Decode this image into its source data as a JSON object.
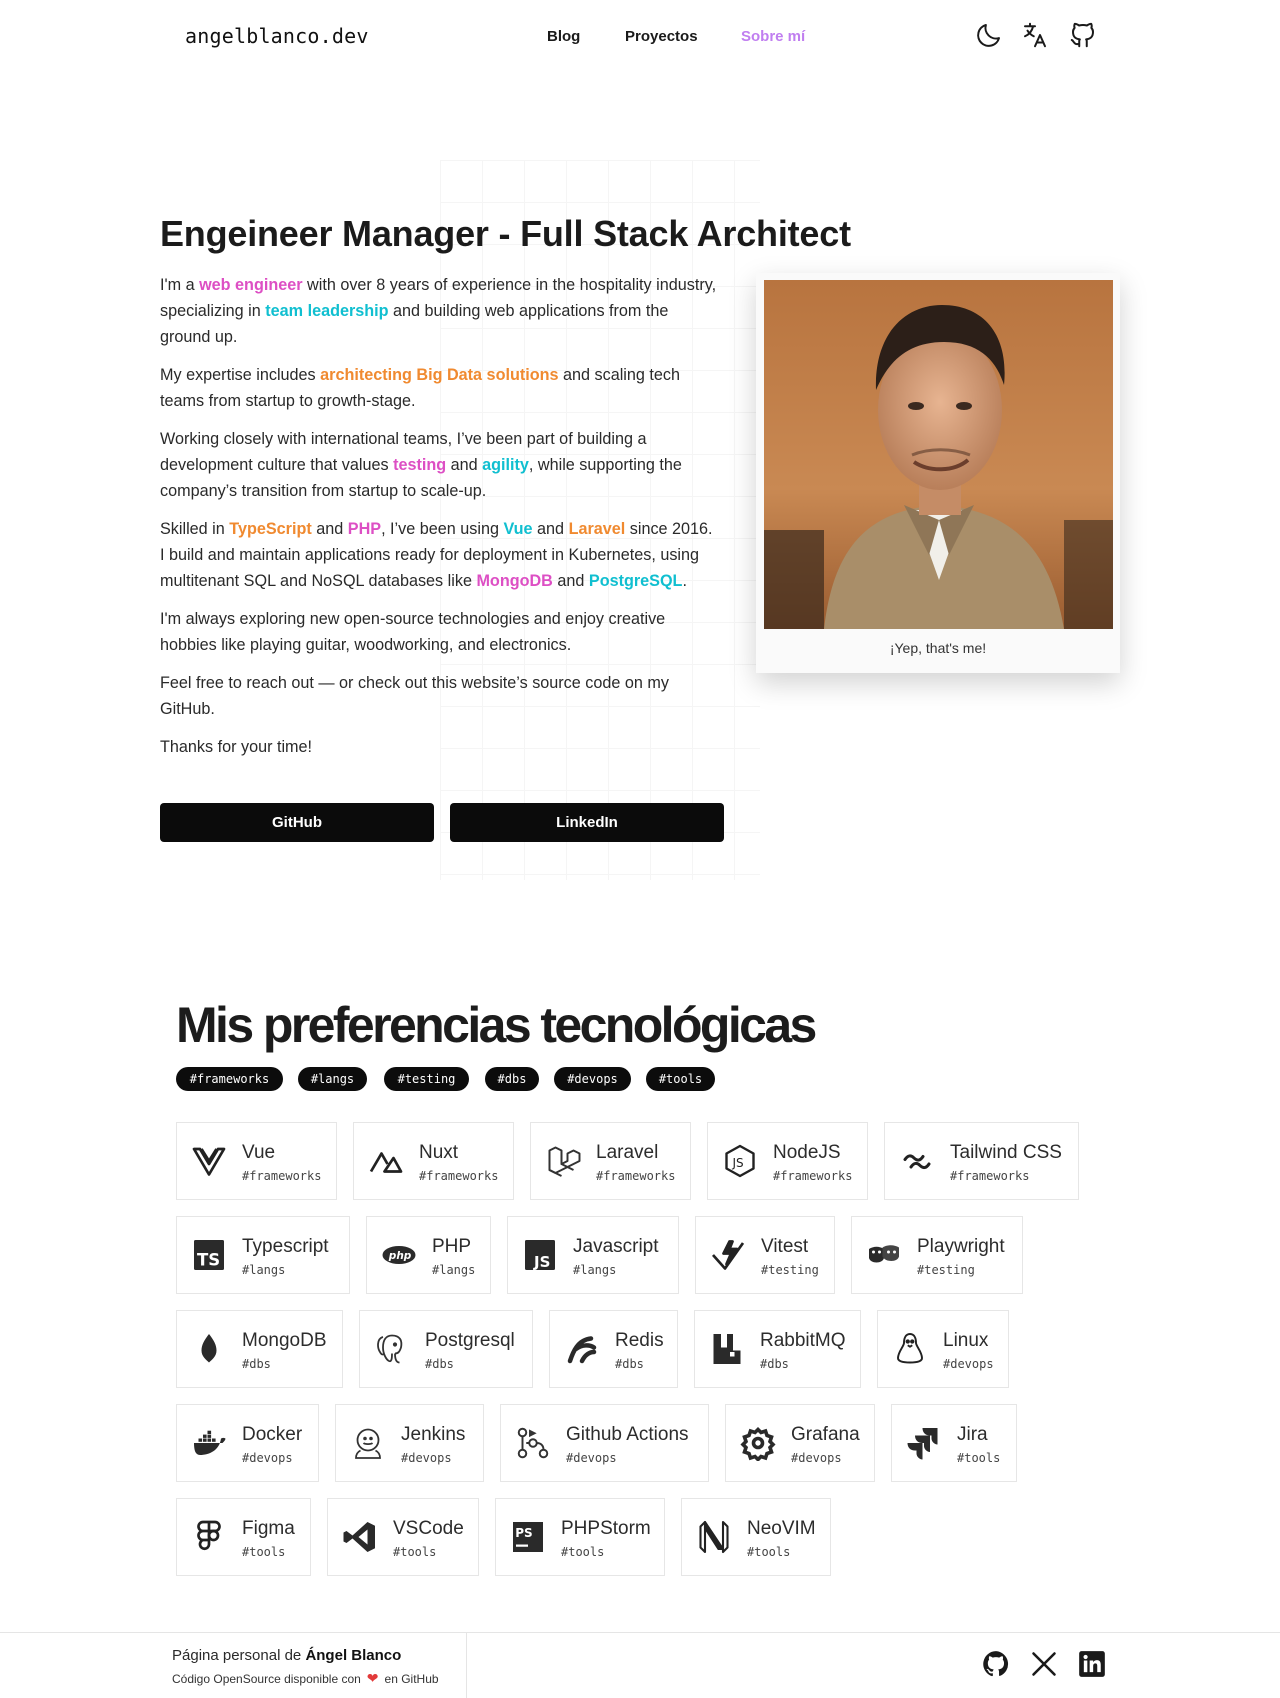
{
  "header": {
    "logo": "angelblanco.dev",
    "nav": [
      "Blog",
      "Proyectos",
      "Sobre mí"
    ],
    "icons": [
      "moon-icon",
      "translate-icon",
      "github-icon"
    ],
    "active_color": "#c07ef0"
  },
  "hero": {
    "title": "Engeineer Manager - Full Stack Architect",
    "p1": [
      "I'm a ",
      "web engineer",
      " with over 8 years of experience in the hospitality industry, specializing in ",
      "team leadership",
      " and building web applications from the ground up."
    ],
    "p2": [
      "My expertise includes ",
      "architecting Big Data solutions",
      " and scaling tech teams from startup to growth-stage."
    ],
    "p3": [
      "Working closely with international teams, I’ve been part of building a development culture that values ",
      "testing",
      " and ",
      "agility",
      ", while supporting the company’s transition from startup to scale-up."
    ],
    "p4": [
      "Skilled in ",
      "TypeScript",
      " and ",
      "PHP",
      ", I’ve been using ",
      "Vue",
      " and ",
      "Laravel",
      " since 2016. I build and maintain applications ready for deployment in Kubernetes, using multitenant SQL and NoSQL databases like ",
      "MongoDB",
      " and ",
      "PostgreSQL",
      "."
    ],
    "p5": "I'm always exploring new open-source technologies and enjoy creative hobbies like playing guitar, woodworking, and electronics.",
    "p6": "Feel free to reach out — or check out this website’s source code on my GitHub.",
    "p7": "Thanks for your time!",
    "buttons": [
      "GitHub",
      "LinkedIn"
    ],
    "photo_caption": "¡Yep, that's me!",
    "colors": {
      "pink": "#dd4fc4",
      "cyan": "#10bfd0",
      "orange": "#f08a30"
    }
  },
  "tech": {
    "title": "Mis preferencias tecnológicas",
    "tags": [
      "#frameworks",
      "#langs",
      "#testing",
      "#dbs",
      "#devops",
      "#tools"
    ],
    "items": [
      {
        "name": "Vue",
        "tag": "#frameworks",
        "icon": "vue-icon"
      },
      {
        "name": "Nuxt",
        "tag": "#frameworks",
        "icon": "nuxt-icon"
      },
      {
        "name": "Laravel",
        "tag": "#frameworks",
        "icon": "laravel-icon"
      },
      {
        "name": "NodeJS",
        "tag": "#frameworks",
        "icon": "nodejs-icon"
      },
      {
        "name": "Tailwind CSS",
        "tag": "#frameworks",
        "icon": "tailwind-icon"
      },
      {
        "name": "Typescript",
        "tag": "#langs",
        "icon": "typescript-icon"
      },
      {
        "name": "PHP",
        "tag": "#langs",
        "icon": "php-icon"
      },
      {
        "name": "Javascript",
        "tag": "#langs",
        "icon": "javascript-icon"
      },
      {
        "name": "Vitest",
        "tag": "#testing",
        "icon": "vitest-icon"
      },
      {
        "name": "Playwright",
        "tag": "#testing",
        "icon": "playwright-icon"
      },
      {
        "name": "MongoDB",
        "tag": "#dbs",
        "icon": "mongodb-icon"
      },
      {
        "name": "Postgresql",
        "tag": "#dbs",
        "icon": "postgresql-icon"
      },
      {
        "name": "Redis",
        "tag": "#dbs",
        "icon": "redis-icon"
      },
      {
        "name": "RabbitMQ",
        "tag": "#dbs",
        "icon": "rabbitmq-icon"
      },
      {
        "name": "Linux",
        "tag": "#devops",
        "icon": "linux-icon"
      },
      {
        "name": "Docker",
        "tag": "#devops",
        "icon": "docker-icon"
      },
      {
        "name": "Jenkins",
        "tag": "#devops",
        "icon": "jenkins-icon"
      },
      {
        "name": "Github Actions",
        "tag": "#devops",
        "icon": "github-actions-icon"
      },
      {
        "name": "Grafana",
        "tag": "#devops",
        "icon": "grafana-icon"
      },
      {
        "name": "Jira",
        "tag": "#tools",
        "icon": "jira-icon"
      },
      {
        "name": "Figma",
        "tag": "#tools",
        "icon": "figma-icon"
      },
      {
        "name": "VSCode",
        "tag": "#tools",
        "icon": "vscode-icon"
      },
      {
        "name": "PHPStorm",
        "tag": "#tools",
        "icon": "phpstorm-icon"
      },
      {
        "name": "NeoVIM",
        "tag": "#tools",
        "icon": "neovim-icon"
      }
    ]
  },
  "footer": {
    "line1_prefix": "Página personal de ",
    "line1_name": "Ángel Blanco",
    "line2_prefix": "Código OpenSource disponible con",
    "line2_suffix": "en GitHub",
    "icons": [
      "github-icon",
      "x-icon",
      "linkedin-icon"
    ]
  }
}
